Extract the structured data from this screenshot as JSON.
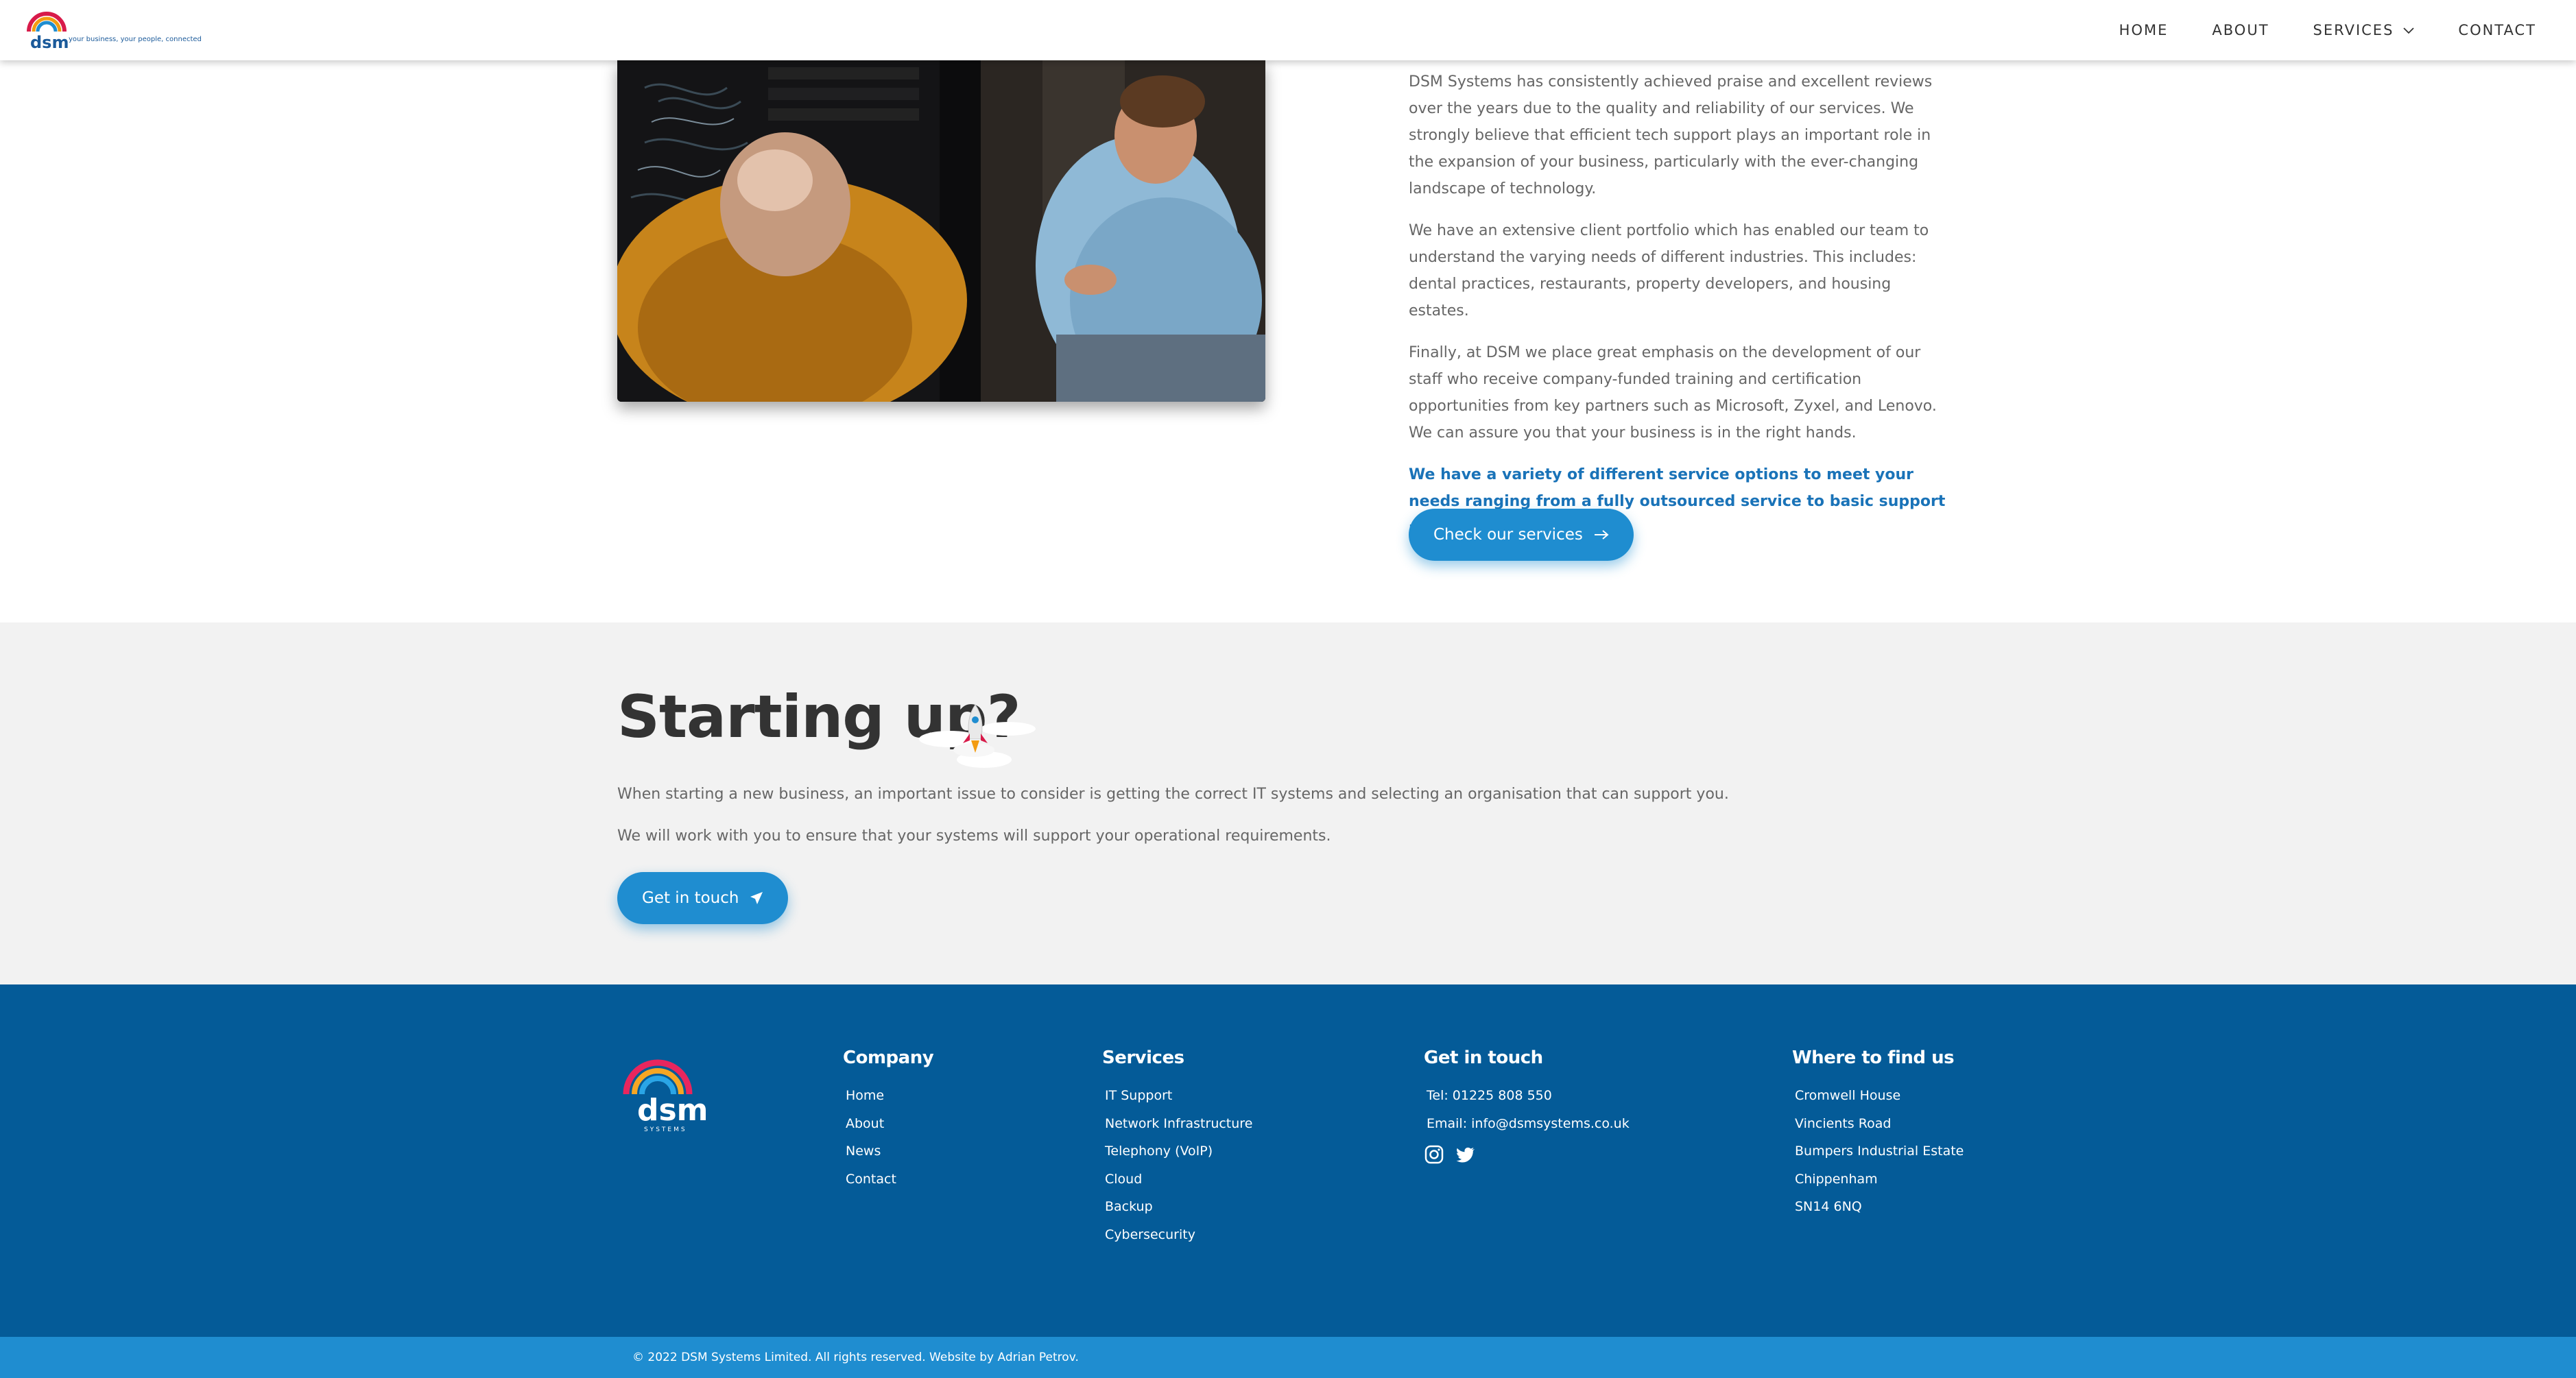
{
  "header": {
    "logo_text": "dsm",
    "logo_tagline": "your business, your people, connected",
    "nav": [
      {
        "label": "HOME"
      },
      {
        "label": "ABOUT"
      },
      {
        "label": "SERVICES",
        "has_dropdown": true
      },
      {
        "label": "CONTACT"
      }
    ]
  },
  "about": {
    "paragraphs": [
      "DSM Systems has consistently achieved praise and excellent reviews over the years due to the quality and reliability of our services. We strongly believe that efficient tech support plays an important role in the expansion of your business, particularly with the ever-changing landscape of technology.",
      "We have an extensive client portfolio which has enabled our team to understand the varying needs of different industries. This includes: dental practices, restaurants, property developers, and housing estates.",
      "Finally, at DSM we place great emphasis on the development of our staff who receive company-funded training and certification opportunities from key partners such as Microsoft, Zyxel, and Lenovo. We can assure you that your business is in the right hands."
    ],
    "highlight": "We have a variety of different service options to meet your needs ranging from a fully outsourced service to basic support packages.",
    "button_label": "Check our services"
  },
  "startup": {
    "title": "Starting up?",
    "p1": "When starting a new business, an important issue to consider is getting the correct IT systems and selecting an organisation that can support you.",
    "p2": "We will work with you to ensure that your systems will support your operational requirements.",
    "button_label": "Get in touch"
  },
  "footer": {
    "logo_text": "dsm",
    "logo_subtext": "SYSTEMS",
    "company": {
      "title": "Company",
      "items": [
        "Home",
        "About",
        "News",
        "Contact"
      ]
    },
    "services": {
      "title": "Services",
      "items": [
        "IT Support",
        "Network Infrastructure",
        "Telephony (VoIP)",
        "Cloud",
        "Backup",
        "Cybersecurity"
      ]
    },
    "contact": {
      "title": "Get in touch",
      "tel": "Tel: 01225 808 550",
      "email": "Email: info@dsmsystems.co.uk"
    },
    "location": {
      "title": "Where to find us",
      "lines": [
        "Cromwell House",
        "Vincients Road",
        "Bumpers Industrial Estate",
        "Chippenham",
        "SN14 6NQ"
      ]
    },
    "copyright": "© 2022 DSM Systems Limited.   All rights reserved.   Website by Adrian Petrov."
  },
  "colors": {
    "accent": "#1f8dd0",
    "footer_bg": "#045b98",
    "highlight_text": "#1a73b8",
    "section_bg": "#f2f2f2"
  },
  "icons": {
    "logo": "rainbow-arc-logo",
    "services_dropdown": "chevron-down-icon",
    "services_button": "arrow-right-icon",
    "touch_button": "paper-plane-icon",
    "startup": "rocket-icon",
    "social": [
      "instagram-icon",
      "twitter-icon"
    ]
  }
}
